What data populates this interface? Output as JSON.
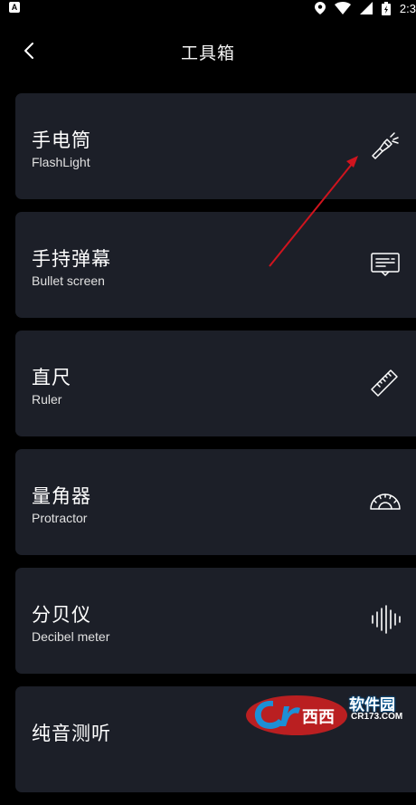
{
  "status_bar": {
    "left_badge": "A",
    "time": "2:3",
    "icons": [
      "location-icon",
      "wifi-icon",
      "signal-icon",
      "battery-icon"
    ]
  },
  "header": {
    "title": "工具箱",
    "back_icon": "chevron-left-icon"
  },
  "tools": [
    {
      "title": "手电筒",
      "subtitle": "FlashLight",
      "icon": "flashlight-icon"
    },
    {
      "title": "手持弹幕",
      "subtitle": "Bullet screen",
      "icon": "bullet-screen-icon"
    },
    {
      "title": "直尺",
      "subtitle": "Ruler",
      "icon": "ruler-icon"
    },
    {
      "title": "量角器",
      "subtitle": "Protractor",
      "icon": "protractor-icon"
    },
    {
      "title": "分贝仪",
      "subtitle": "Decibel meter",
      "icon": "decibel-icon"
    },
    {
      "title": "纯音测听",
      "subtitle": "",
      "icon": ""
    }
  ],
  "watermark": {
    "brand": "软件园",
    "url": "CR173.COM"
  },
  "colors": {
    "background": "#000000",
    "card": "#1c1f28",
    "annotation_arrow": "#d0141e"
  }
}
